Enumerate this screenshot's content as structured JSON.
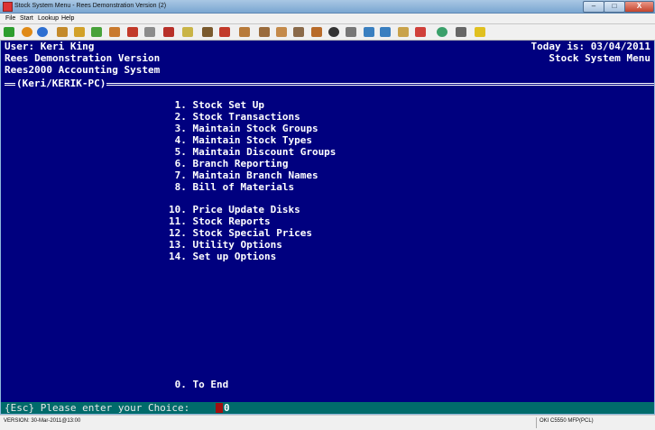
{
  "window": {
    "title": "Stock System Menu - Rees Demonstration Version (2)",
    "min_label": "–",
    "max_label": "□",
    "close_label": "X"
  },
  "menubar": {
    "items": [
      "File",
      "Start",
      "Lookup",
      "Help"
    ]
  },
  "toolbar": {
    "icons": [
      {
        "name": "back-arrow-icon",
        "color": "#2e9e2e"
      },
      {
        "name": "help-icon",
        "color": "#e08a16"
      },
      {
        "name": "info-icon",
        "color": "#2d6fd1"
      },
      {
        "name": "calendar-icon",
        "color": "#c48a2a"
      },
      {
        "name": "pencil-icon",
        "color": "#d2a129"
      },
      {
        "name": "leaf-icon",
        "color": "#48a23a"
      },
      {
        "name": "person-icon",
        "color": "#c97a2e"
      },
      {
        "name": "person-stop-icon",
        "color": "#c23a2a"
      },
      {
        "name": "paper-search-icon",
        "color": "#8c8c8c"
      },
      {
        "name": "book-icon",
        "color": "#b8312a"
      },
      {
        "name": "document-icon",
        "color": "#c9b447"
      },
      {
        "name": "people-icon",
        "color": "#7a5a2e"
      },
      {
        "name": "truck-icon",
        "color": "#c23a2a"
      },
      {
        "name": "box-icon",
        "color": "#b77a3a"
      },
      {
        "name": "delivery-icon",
        "color": "#9a6b3c"
      },
      {
        "name": "parcel-icon",
        "color": "#c48a4a"
      },
      {
        "name": "tools-icon",
        "color": "#8a6a4a"
      },
      {
        "name": "tag-icon",
        "color": "#b86b2a"
      },
      {
        "name": "disc-icon",
        "color": "#333333"
      },
      {
        "name": "wrench-icon",
        "color": "#777777"
      },
      {
        "name": "chart-icon",
        "color": "#3a7fc0"
      },
      {
        "name": "filter-icon",
        "color": "#3a7fc0"
      },
      {
        "name": "broom-icon",
        "color": "#c9a24a"
      },
      {
        "name": "phone-icon",
        "color": "#d0403a"
      },
      {
        "name": "globe-icon",
        "color": "#3aa06a"
      },
      {
        "name": "printer-icon",
        "color": "#666666"
      },
      {
        "name": "pen-icon",
        "color": "#e0c020"
      }
    ]
  },
  "terminal": {
    "user": "User: Keri King",
    "today": "Today is: 03/04/2011",
    "version": "Rees Demonstration Version",
    "system_menu": "Stock System Menu",
    "system_name": "Rees2000 Accounting System",
    "session": "(Keri/KERIK-PC)",
    "menu_group1": [
      " 1. Stock Set Up",
      " 2. Stock Transactions",
      " 3. Maintain Stock Groups",
      " 4. Maintain Stock Types",
      " 5. Maintain Discount Groups",
      " 6. Branch Reporting",
      " 7. Maintain Branch Names",
      " 8. Bill of Materials"
    ],
    "menu_group2": [
      "10. Price Update Disks",
      "11. Stock Reports",
      "12. Stock Special Prices",
      "13. Utility Options",
      "14. Set up Options"
    ],
    "end_option": " 0. To End"
  },
  "prompt": {
    "text": "{Esc} Please enter your Choice:",
    "choice": "0"
  },
  "statusbar": {
    "version": "VERSION: 30-Mar-2011@13:00",
    "printer": "OKI C5550 MFP(PCL)"
  }
}
